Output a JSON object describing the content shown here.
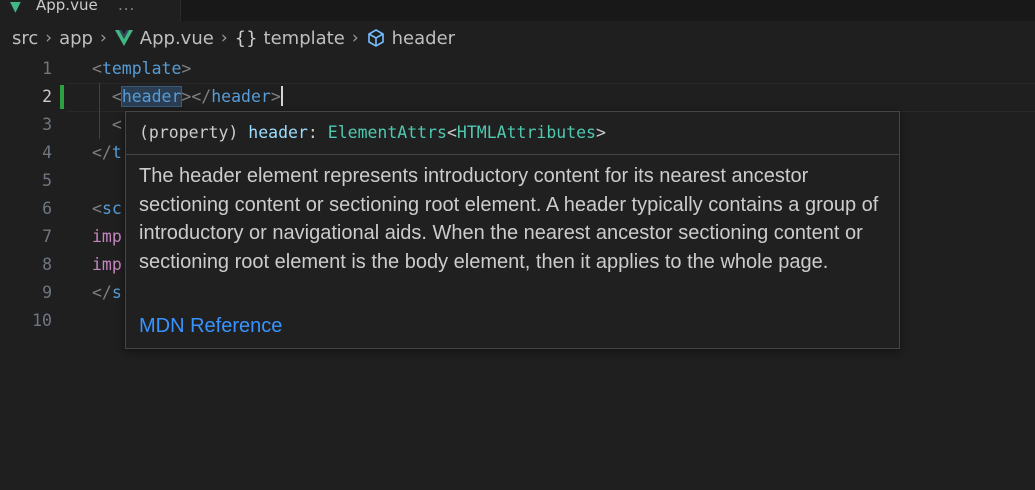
{
  "tab": {
    "label": "App.vue",
    "dots": "..."
  },
  "breadcrumb": {
    "items": [
      "src",
      "app",
      "App.vue",
      "template",
      "header"
    ],
    "icons": [
      "vue-logo-icon",
      "braces-icon",
      "cube-icon"
    ]
  },
  "colors": {
    "vue_green": "#41b883",
    "tag_blue": "#569cd6",
    "type_teal": "#4ec9b0",
    "link_blue": "#3794ff",
    "modified_gutter": "#2ea043"
  },
  "editor": {
    "active_line": 2,
    "line_numbers": [
      "1",
      "2",
      "3",
      "4",
      "5",
      "6",
      "7",
      "8",
      "9",
      "10"
    ],
    "lines": {
      "l1": {
        "open": "<",
        "name": "template",
        "close": ">"
      },
      "l2": {
        "open": "<",
        "name": "header",
        "close": "></",
        "name2": "header",
        "close2": ">"
      },
      "l3": {
        "open": "<"
      },
      "l4": {
        "open": "</",
        "name": "t"
      },
      "l6": {
        "open": "<",
        "name": "sc"
      },
      "l7": {
        "kw": "imp"
      },
      "l8": {
        "kw": "imp"
      },
      "l9": {
        "open": "</",
        "name": "s"
      }
    }
  },
  "hover": {
    "signature": {
      "prefix": "(property) ",
      "name": "header",
      "colon": ": ",
      "type": "ElementAttrs",
      "lt": "<",
      "type_arg": "HTMLAttributes",
      "gt": ">"
    },
    "description": "The header element represents introductory content for its nearest ancestor sectioning content or sectioning root element. A header typically contains a group of introductory or navigational aids. When the nearest ancestor sectioning content or sectioning root element is the body element, then it applies to the whole page.",
    "link": "MDN Reference"
  }
}
